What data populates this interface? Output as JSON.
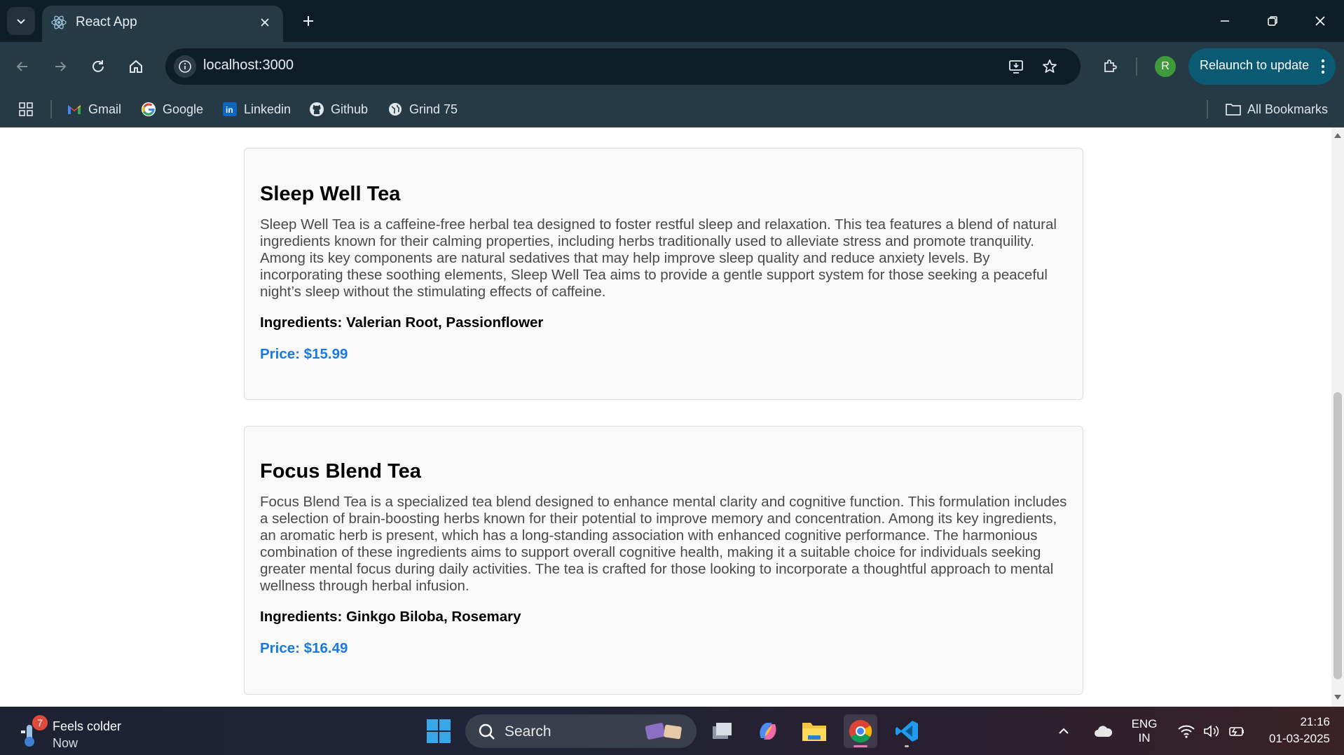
{
  "browser": {
    "tab_title": "React App",
    "url": "localhost:3000",
    "profile_initial": "R",
    "relaunch_label": "Relaunch to update",
    "bookmarks": [
      "Gmail",
      "Google",
      "Linkedin",
      "Github",
      "Grind 75"
    ],
    "all_bookmarks_label": "All Bookmarks"
  },
  "products": [
    {
      "name": "Sleep Well Tea",
      "description": "Sleep Well Tea is a caffeine-free herbal tea designed to foster restful sleep and relaxation. This tea features a blend of natural ingredients known for their calming properties, including herbs traditionally used to alleviate stress and promote tranquility. Among its key components are natural sedatives that may help improve sleep quality and reduce anxiety levels. By incorporating these soothing elements, Sleep Well Tea aims to provide a gentle support system for those seeking a peaceful night’s sleep without the stimulating effects of caffeine.",
      "ingredients": "Ingredients: Valerian Root, Passionflower",
      "price": "Price: $15.99"
    },
    {
      "name": "Focus Blend Tea",
      "description": "Focus Blend Tea is a specialized tea blend designed to enhance mental clarity and cognitive function. This formulation includes a selection of brain-boosting herbs known for their potential to improve memory and concentration. Among its key ingredients, an aromatic herb is present, which has a long-standing association with enhanced cognitive performance. The harmonious combination of these ingredients aims to support overall cognitive health, making it a suitable choice for individuals seeking greater mental focus during daily activities. The tea is crafted for those looking to incorporate a thoughtful approach to mental wellness through herbal infusion.",
      "ingredients": "Ingredients: Ginkgo Biloba, Rosemary",
      "price": "Price: $16.49"
    }
  ],
  "taskbar": {
    "weather_badge": "7",
    "weather_title": "Feels colder",
    "weather_sub": "Now",
    "search_label": "Search",
    "lang_top": "ENG",
    "lang_bottom": "IN",
    "time": "21:16",
    "date": "01-03-2025"
  }
}
